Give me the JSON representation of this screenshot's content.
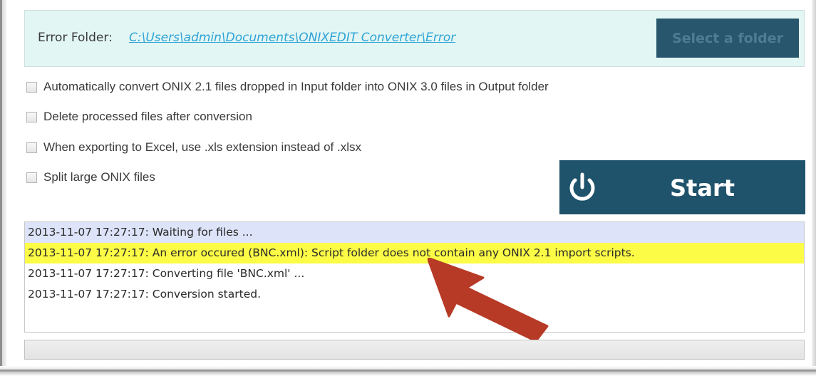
{
  "error_folder": {
    "label": "Error Folder:",
    "path": "C:\\Users\\admin\\Documents\\ONIXEDIT Converter\\Error",
    "select_button": "Select a folder"
  },
  "options": [
    {
      "label": "Automatically convert ONIX 2.1 files dropped in Input folder into ONIX 3.0 files in Output folder",
      "checked": false
    },
    {
      "label": "Delete processed files after conversion",
      "checked": false
    },
    {
      "label": "When exporting to Excel, use .xls extension instead of .xlsx",
      "checked": false
    },
    {
      "label": "Split large ONIX files",
      "checked": false
    }
  ],
  "start_button": {
    "label": "Start",
    "icon": "power-icon"
  },
  "log": [
    {
      "text": "2013-11-07 17:27:17: Waiting for files ...",
      "state": "selected"
    },
    {
      "text": "2013-11-07 17:27:17: An error occured (BNC.xml): Script folder does not contain any ONIX 2.1 import scripts.",
      "state": "error"
    },
    {
      "text": "2013-11-07 17:27:17: Converting file 'BNC.xml' ...",
      "state": "normal"
    },
    {
      "text": "2013-11-07 17:27:17: Conversion started.",
      "state": "normal"
    }
  ],
  "colors": {
    "panel_bg": "#e2f6f4",
    "accent_dark": "#1f526b",
    "link": "#2ea3d6",
    "error_highlight": "#fcfc46",
    "selected_row": "#dde3f8",
    "arrow": "#b63a26"
  }
}
